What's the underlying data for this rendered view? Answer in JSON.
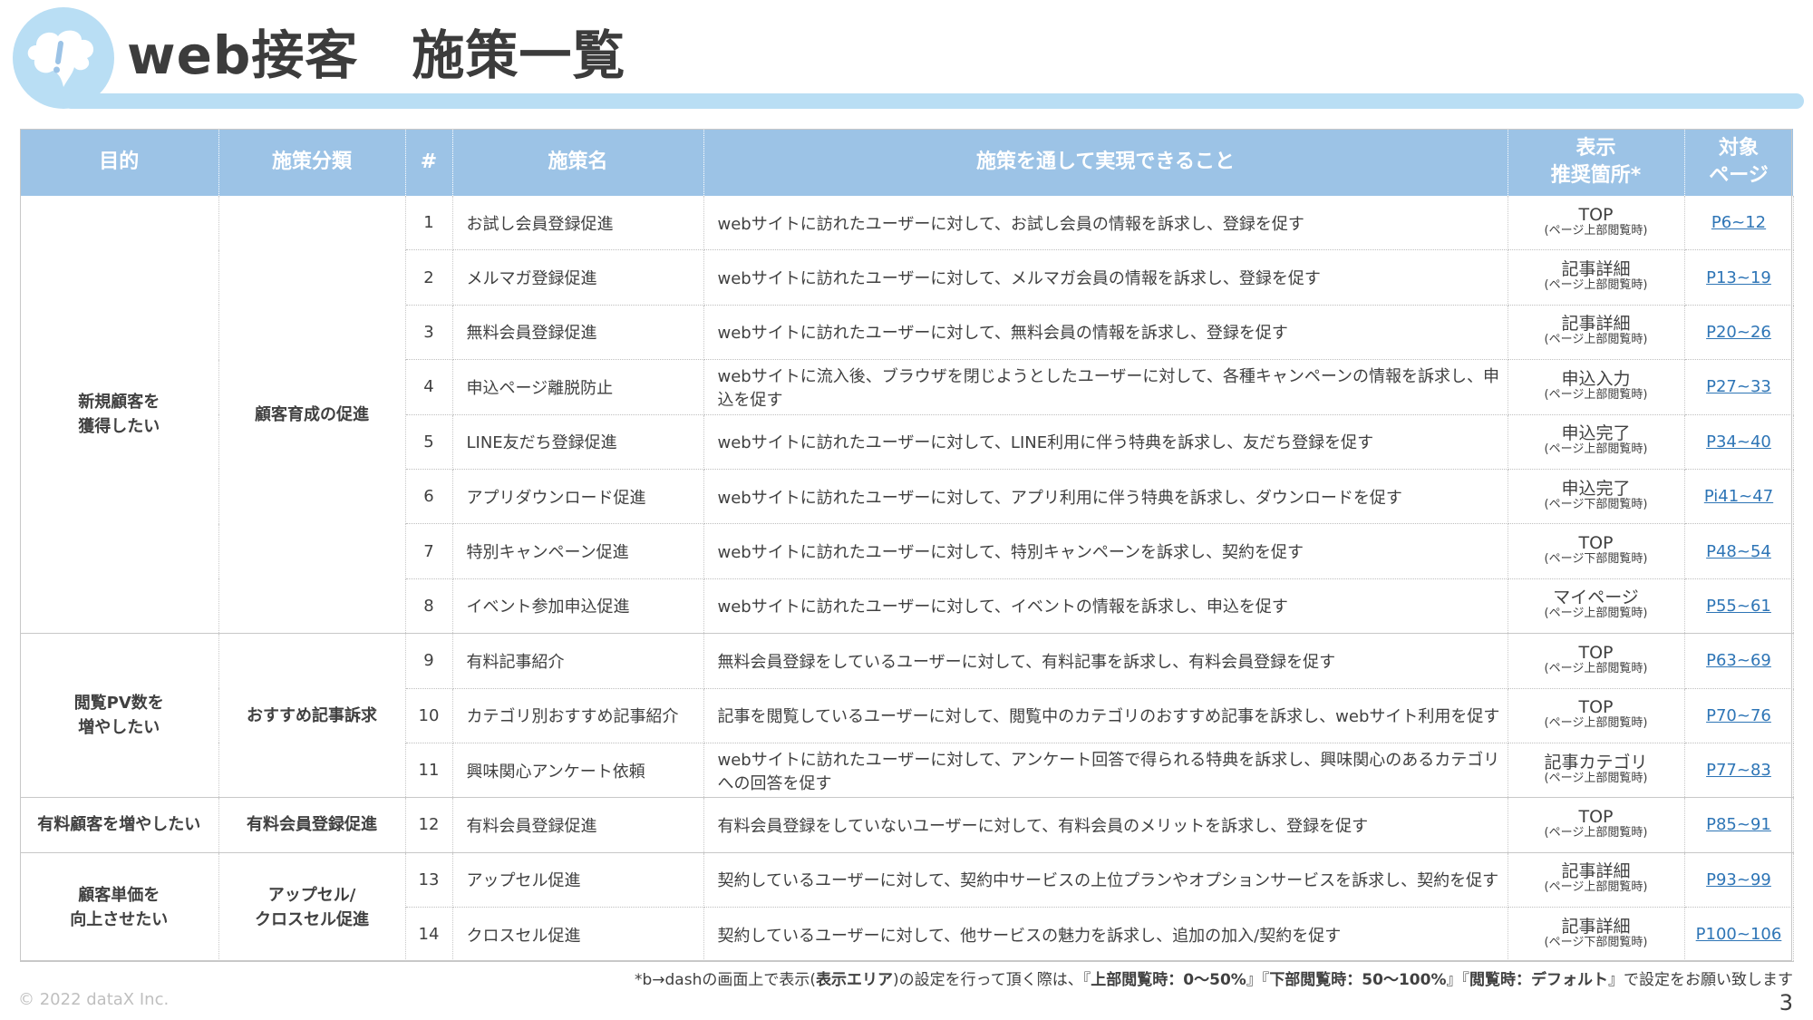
{
  "header": {
    "title": "web接客　施策一覧"
  },
  "table": {
    "columns": [
      "目的",
      "施策分類",
      "#",
      "施策名",
      "施策を通して実現できること",
      "表示\n推奨箇所*",
      "対象\nページ"
    ],
    "groups": [
      {
        "purpose": "新規顧客を\n獲得したい",
        "category": "顧客育成の促進"
      },
      {
        "purpose": "閲覧PV数を\n増やしたい",
        "category": "おすすめ記事訴求"
      },
      {
        "purpose": "有料顧客を増やしたい",
        "category": "有料会員登録促進"
      },
      {
        "purpose": "顧客単価を\n向上させたい",
        "category": "アップセル/\nクロスセル促進"
      }
    ],
    "rows": [
      {
        "num": "1",
        "name": "お試し会員登録促進",
        "desc": "webサイトに訪れたユーザーに対して、お試し会員の情報を訴求し、登録を促す",
        "loc": "TOP",
        "loc_sub": "(ページ上部閲覧時)",
        "page": "P6~12"
      },
      {
        "num": "2",
        "name": "メルマガ登録促進",
        "desc": "webサイトに訪れたユーザーに対して、メルマガ会員の情報を訴求し、登録を促す",
        "loc": "記事詳細",
        "loc_sub": "(ページ上部閲覧時)",
        "page": "P13~19"
      },
      {
        "num": "3",
        "name": "無料会員登録促進",
        "desc": "webサイトに訪れたユーザーに対して、無料会員の情報を訴求し、登録を促す",
        "loc": "記事詳細",
        "loc_sub": "(ページ上部閲覧時)",
        "page": "P20~26"
      },
      {
        "num": "4",
        "name": "申込ページ離脱防止",
        "desc": "webサイトに流入後、ブラウザを閉じようとしたユーザーに対して、各種キャンペーンの情報を訴求し、申込を促す",
        "loc": "申込入力",
        "loc_sub": "(ページ上部閲覧時)",
        "page": "P27~33"
      },
      {
        "num": "5",
        "name": "LINE友だち登録促進",
        "desc": "webサイトに訪れたユーザーに対して、LINE利用に伴う特典を訴求し、友だち登録を促す",
        "loc": "申込完了",
        "loc_sub": "(ページ上部閲覧時)",
        "page": "P34~40"
      },
      {
        "num": "6",
        "name": "アプリダウンロード促進",
        "desc": "webサイトに訪れたユーザーに対して、アプリ利用に伴う特典を訴求し、ダウンロードを促す",
        "loc": "申込完了",
        "loc_sub": "(ページ下部閲覧時)",
        "page": "Pi41~47"
      },
      {
        "num": "7",
        "name": "特別キャンペーン促進",
        "desc": "webサイトに訪れたユーザーに対して、特別キャンペーンを訴求し、契約を促す",
        "loc": "TOP",
        "loc_sub": "(ページ下部閲覧時)",
        "page": "P48~54"
      },
      {
        "num": "8",
        "name": "イベント参加申込促進",
        "desc": "webサイトに訪れたユーザーに対して、イベントの情報を訴求し、申込を促す",
        "loc": "マイページ",
        "loc_sub": "(ページ上部閲覧時)",
        "page": "P55~61"
      },
      {
        "num": "9",
        "name": "有料記事紹介",
        "desc": "無料会員登録をしているユーザーに対して、有料記事を訴求し、有料会員登録を促す",
        "loc": "TOP",
        "loc_sub": "(ページ上部閲覧時)",
        "page": "P63~69"
      },
      {
        "num": "10",
        "name": "カテゴリ別おすすめ記事紹介",
        "desc": "記事を閲覧しているユーザーに対して、閲覧中のカテゴリのおすすめ記事を訴求し、webサイト利用を促す",
        "loc": "TOP",
        "loc_sub": "(ページ上部閲覧時)",
        "page": "P70~76"
      },
      {
        "num": "11",
        "name": "興味関心アンケート依頼",
        "desc": "webサイトに訪れたユーザーに対して、アンケート回答で得られる特典を訴求し、興味関心のあるカテゴリへの回答を促す",
        "loc": "記事カテゴリ",
        "loc_sub": "(ページ上部閲覧時)",
        "page": "P77~83"
      },
      {
        "num": "12",
        "name": "有料会員登録促進",
        "desc": "有料会員登録をしていないユーザーに対して、有料会員のメリットを訴求し、登録を促す",
        "loc": "TOP",
        "loc_sub": "(ページ上部閲覧時)",
        "page": "P85~91"
      },
      {
        "num": "13",
        "name": "アップセル促進",
        "desc": "契約しているユーザーに対して、契約中サービスの上位プランやオプションサービスを訴求し、契約を促す",
        "loc": "記事詳細",
        "loc_sub": "(ページ上部閲覧時)",
        "page": "P93~99"
      },
      {
        "num": "14",
        "name": "クロスセル促進",
        "desc": "契約しているユーザーに対して、他サービスの魅力を訴求し、追加の加入/契約を促す",
        "loc": "記事詳細",
        "loc_sub": "(ページ下部閲覧時)",
        "page": "P100~106"
      }
    ]
  },
  "footnote": {
    "part1": "*b→dashの画面上で表示(",
    "bold1": "表示エリア",
    "part2": ")の設定を行って頂く際は、『",
    "bold2": "上部閲覧時：0～50%",
    "part3": "』『",
    "bold3": "下部閲覧時：50～100%",
    "part4": "』『",
    "bold4": "閲覧時：デフォルト",
    "part5": "』で設定をお願い致します"
  },
  "copyright": "© 2022 dataX Inc.",
  "page_number": "3",
  "colors": {
    "header_fill": "#9cc3e6",
    "accent_light": "#b9def4",
    "link": "#2e75b6"
  },
  "icons": {
    "logo": "speech-bubble-exclamation-icon"
  }
}
